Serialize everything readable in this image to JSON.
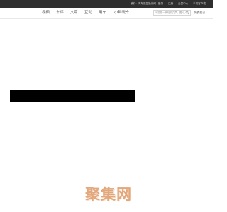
{
  "topbar": {
    "items": [
      "我们：汽车质量投诉网",
      "登录",
      "注册",
      "会员中心",
      "手机客户端"
    ]
  },
  "nav": {
    "items": [
      "视频",
      "车评",
      "文章",
      "互动",
      "用车",
      "小鲜说车"
    ]
  },
  "search": {
    "placeholder": "可能是一辆轻的文章、图片、视频",
    "button_label": "免费投诉"
  },
  "footer": {
    "logo_text": "聚集网"
  },
  "colors": {
    "topbar_bg": "#2f2f2f",
    "banner": "#000000",
    "logo": "#e2a77a"
  }
}
